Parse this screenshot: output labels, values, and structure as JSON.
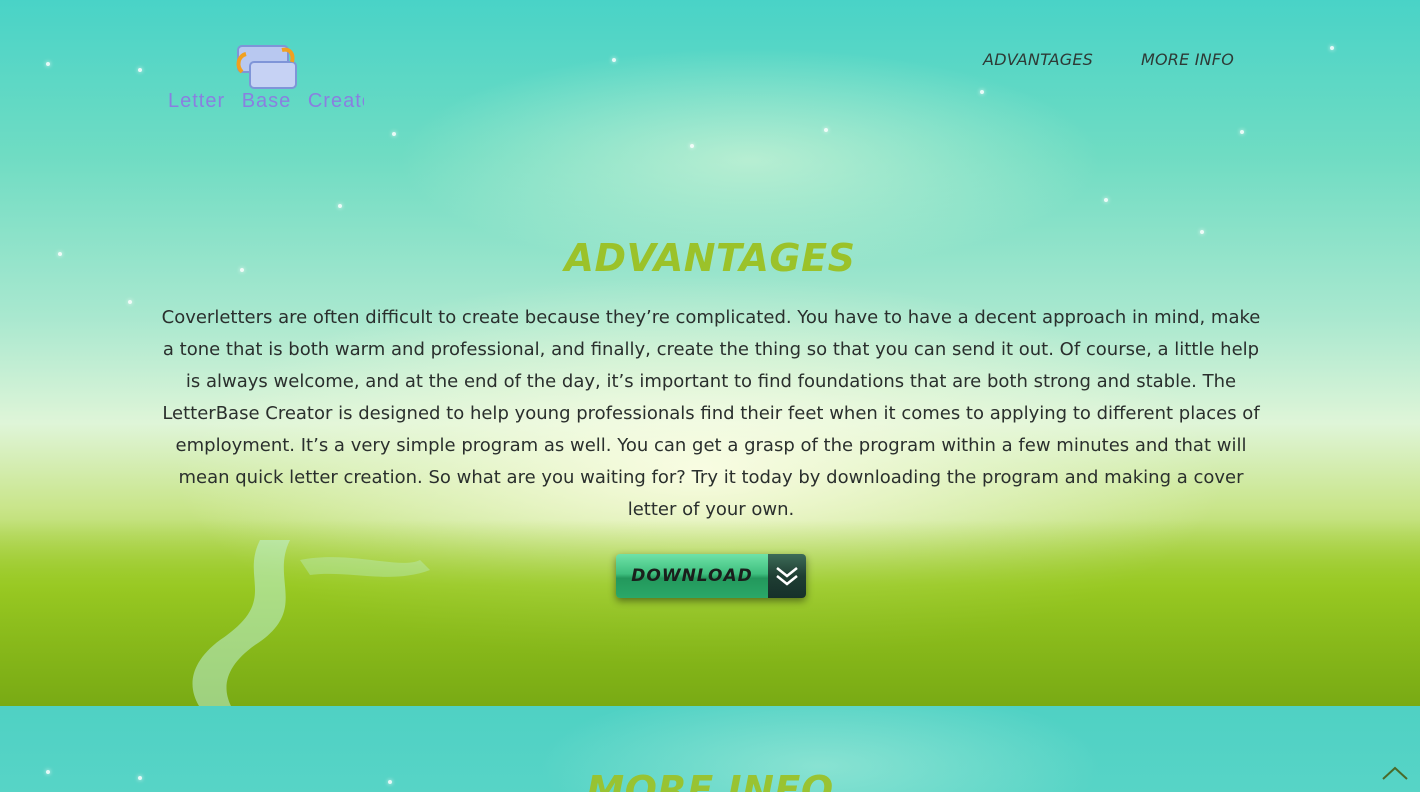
{
  "header": {
    "logo_text": "Letter Base Creator",
    "nav": [
      {
        "label": "ADVANTAGES"
      },
      {
        "label": "MORE INFO"
      }
    ]
  },
  "advantages": {
    "title": "ADVANTAGES",
    "body": "Coverletters are often difficult to create because they’re complicated. You have to have a decent approach in mind, make a tone that is both warm and professional, and finally, create the thing so that you can send it out. Of course, a little help is always welcome, and at the end of the day, it’s important to find foundations that are both strong and stable. The LetterBase Creator is designed to help young professionals find their feet when it comes to applying to different places of employment. It’s a very simple program as well. You can get a grasp of the program within a few minutes and that will mean quick letter creation. So what are you waiting for? Try it today by downloading the program and making a cover letter of your own.",
    "download_label": "DOWNLOAD"
  },
  "more_info": {
    "title": "MORE INFO"
  },
  "icons": {
    "download_arrow": "double-chevron-down-icon",
    "back_to_top": "chevron-up-icon",
    "logo": "swap-windows-logo"
  },
  "colors": {
    "title_green": "#9bc22a",
    "logo_text": "#8a7fe0",
    "nav_text": "#2e3a36"
  }
}
